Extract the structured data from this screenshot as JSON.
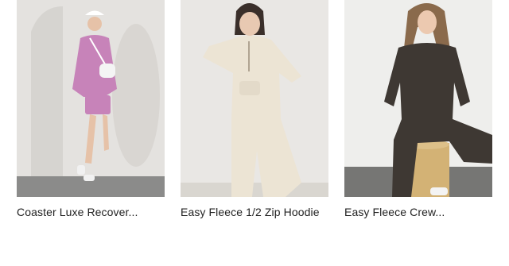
{
  "products": [
    {
      "title": "Coaster Luxe Recover...",
      "image_alt": "Model in pink sweatshirt and pink shorts with white crossbody bag and white cap",
      "colors": {
        "background": "#e4e2df",
        "floor": "#8b8b8a",
        "top": "#c783b9",
        "bottom": "#c783b9"
      }
    },
    {
      "title": "Easy Fleece 1/2 Zip Hoodie",
      "image_alt": "Model in cream half-zip fleece hoodie and cream sweatpants",
      "colors": {
        "background": "#e9e7e4",
        "floor": "#d9d6d0",
        "top": "#ece4d4",
        "bottom": "#ece4d4"
      }
    },
    {
      "title": "Easy Fleece Crew...",
      "image_alt": "Model in dark brown crew sweatshirt and brown joggers seated on a wooden stool",
      "colors": {
        "background": "#eeeeec",
        "floor": "#767674",
        "top": "#3e3833",
        "bottom": "#3e3833"
      }
    }
  ]
}
